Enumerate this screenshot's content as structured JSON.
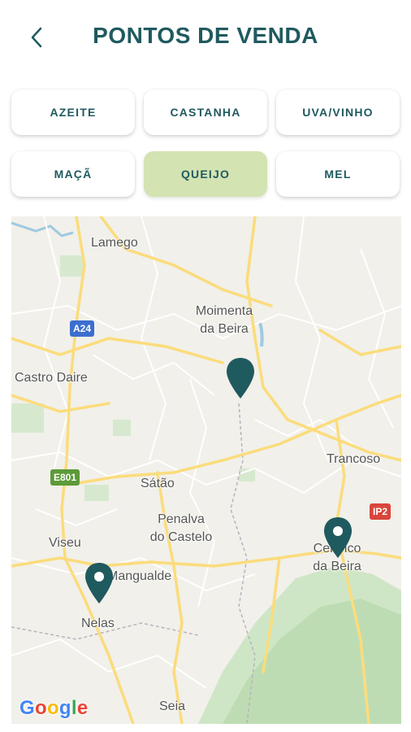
{
  "header": {
    "title": "PONTOS DE VENDA"
  },
  "categories": [
    {
      "label": "AZEITE",
      "active": false
    },
    {
      "label": "CASTANHA",
      "active": false
    },
    {
      "label": "UVA/VINHO",
      "active": false
    },
    {
      "label": "MAÇÃ",
      "active": false
    },
    {
      "label": "QUEIJO",
      "active": true
    },
    {
      "label": "MEL",
      "active": false
    }
  ],
  "map": {
    "places": {
      "lamego": "Lamego",
      "moimenta": "Moimenta\nda Beira",
      "castro_daire": "Castro Daire",
      "trancoso": "Trancoso",
      "satao": "Sátão",
      "penalva": "Penalva\ndo Castelo",
      "viseu": "Viseu",
      "celorico": "Celorico\nda Beira",
      "mangualde": "Mangualde",
      "nelas": "Nelas",
      "seia": "Seia"
    },
    "road_labels": {
      "a24": "A24",
      "e801": "E801",
      "ip2": "IP2"
    },
    "attribution": "Google",
    "colors": {
      "pin": "#1f5a5f",
      "accent": "#1f5a5f",
      "active_chip": "#d3e3b2"
    }
  }
}
